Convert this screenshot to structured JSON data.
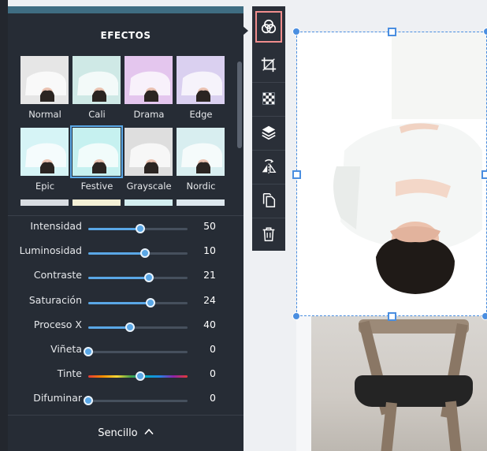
{
  "panel": {
    "title": "EFECTOS",
    "mode_toggle_label": "Sencillo",
    "mode_toggle_icon": "chevron-up-icon"
  },
  "filters": [
    {
      "label": "Normal",
      "tint": "#e6e6e6",
      "selected": false
    },
    {
      "label": "Cali",
      "tint": "#cfe9e6",
      "selected": false
    },
    {
      "label": "Drama",
      "tint": "#e4c6ee",
      "selected": false
    },
    {
      "label": "Edge",
      "tint": "#dad0f0",
      "selected": false
    },
    {
      "label": "Epic",
      "tint": "#d6f4f6",
      "selected": false
    },
    {
      "label": "Festive",
      "tint": "#c6f1f0",
      "selected": true
    },
    {
      "label": "Grayscale",
      "tint": "#dedede",
      "selected": false
    },
    {
      "label": "Nordic",
      "tint": "#d8eef0",
      "selected": false
    }
  ],
  "adjustments": [
    {
      "label": "Intensidad",
      "value": "50",
      "level": 0.52,
      "style": "blue"
    },
    {
      "label": "Luminosidad",
      "value": "10",
      "level": 0.57,
      "style": "blue"
    },
    {
      "label": "Contraste",
      "value": "21",
      "level": 0.61,
      "style": "blue"
    },
    {
      "label": "Saturación",
      "value": "24",
      "level": 0.63,
      "style": "blue"
    },
    {
      "label": "Proceso X",
      "value": "40",
      "level": 0.42,
      "style": "blue"
    },
    {
      "label": "Viñeta",
      "value": "0",
      "level": 0.0,
      "style": "blue"
    },
    {
      "label": "Tinte",
      "value": "0",
      "level": 0.52,
      "style": "rainbow"
    },
    {
      "label": "Difuminar",
      "value": "0",
      "level": 0.0,
      "style": "blue"
    }
  ],
  "toolbar": [
    {
      "name": "effects-icon",
      "active": true
    },
    {
      "name": "crop-icon",
      "active": false
    },
    {
      "name": "transparency-icon",
      "active": false
    },
    {
      "name": "layers-icon",
      "active": false
    },
    {
      "name": "flip-icon",
      "active": false
    },
    {
      "name": "duplicate-icon",
      "active": false
    },
    {
      "name": "trash-icon",
      "active": false
    }
  ],
  "colors": {
    "accent": "#5aa7e6",
    "active_tool_border": "#f08d8d",
    "panel_bg": "#262c35",
    "toolbar_bg": "#2a2f38",
    "selection": "#4a8ee0"
  }
}
